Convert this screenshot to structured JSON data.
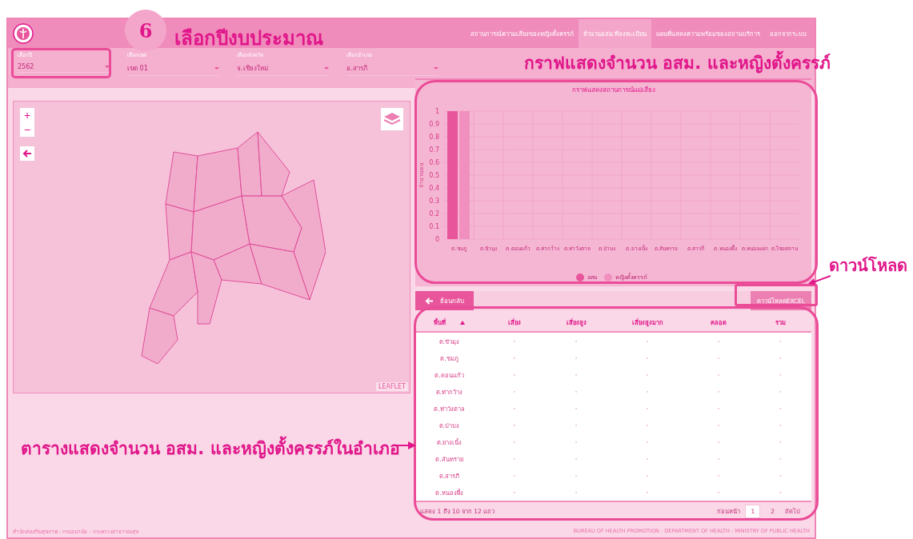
{
  "header": {
    "nav": [
      {
        "label": "สถานการณ์ความเสี่ยงของหญิงตั้งครรภ์",
        "selected": false
      },
      {
        "label": "จำนวนอสม.ที่ลงทะเบียน",
        "selected": true
      },
      {
        "label": "แผนที่แสดงความพร้อมของสถานบริการ",
        "selected": false
      },
      {
        "label": "ออกจากระบบ",
        "selected": false
      }
    ]
  },
  "filters": [
    {
      "label": "เลือกปี",
      "value": "2562"
    },
    {
      "label": "เลือกเขต",
      "value": "เขต 01"
    },
    {
      "label": "เลือกจังหวัด",
      "value": "จ.เชียงใหม่"
    },
    {
      "label": "เลือกอำเภอ",
      "value": "อ.สารภี"
    }
  ],
  "map": {
    "zoom_in": "+",
    "zoom_out": "−",
    "attribution": "LEAFLET"
  },
  "chart": {
    "chart_data": {
      "type": "bar",
      "title": "กราฟแสดงสถานการณ์แม่เสี่ยง",
      "ylabel": "จำนวนคน",
      "categories": [
        "ต.ชมภู",
        "ต.ขัวมุง",
        "ต.ดอนแก้ว",
        "ต.ท่ากว้าง",
        "ต.ท่าวังตาล",
        "ต.ป่าบง",
        "ต.ยางเนิ้ง",
        "ต.สันทราย",
        "ต.สารภี",
        "ต.หนองผึ้ง",
        "ต.หนองแฝก",
        "ต.ไชยสถาน"
      ],
      "series": [
        {
          "name": "อสม",
          "color": "#e8559b",
          "values": [
            1,
            0,
            0,
            0,
            0,
            0,
            0,
            0,
            0,
            0,
            0,
            0
          ]
        },
        {
          "name": "หญิงตั้งครรภ์",
          "color": "#f190bf",
          "values": [
            1,
            0,
            0,
            0,
            0,
            0,
            0,
            0,
            0,
            0,
            0,
            0
          ]
        }
      ],
      "grid": true,
      "ylim": [
        0,
        1
      ],
      "yticks": [
        0,
        0.1,
        0.2,
        0.3,
        0.4,
        0.5,
        0.6,
        0.7,
        0.8,
        0.9,
        1
      ]
    }
  },
  "toolbar": {
    "back": "ย้อนกลับ",
    "download": "ดาวน์โหลดEXCEL"
  },
  "table": {
    "columns": [
      {
        "label": "พื้นที่",
        "sorted": true
      },
      {
        "label": "เสี่ยง",
        "sorted": false
      },
      {
        "label": "เสี่ยงสูง",
        "sorted": false
      },
      {
        "label": "เสี่ยงสูงมาก",
        "sorted": false
      },
      {
        "label": "คลอด",
        "sorted": false
      },
      {
        "label": "รวม",
        "sorted": false
      }
    ],
    "rows": [
      {
        "cells": [
          "ต.ขัวมุง",
          "-",
          "-",
          "-",
          "-",
          "-"
        ]
      },
      {
        "cells": [
          "ต.ชมภู",
          "-",
          "-",
          "-",
          "-",
          "-"
        ]
      },
      {
        "cells": [
          "ต.ดอนแก้ว",
          "-",
          "-",
          "-",
          "-",
          "-"
        ]
      },
      {
        "cells": [
          "ต.ท่ากว้าง",
          "-",
          "-",
          "-",
          "-",
          "-"
        ]
      },
      {
        "cells": [
          "ต.ท่าวังตาล",
          "-",
          "-",
          "-",
          "-",
          "-"
        ]
      },
      {
        "cells": [
          "ต.ป่าบง",
          "-",
          "-",
          "-",
          "-",
          "-"
        ]
      },
      {
        "cells": [
          "ต.ยางเนิ้ง",
          "-",
          "-",
          "-",
          "-",
          "-"
        ]
      },
      {
        "cells": [
          "ต.สันทราย",
          "-",
          "-",
          "-",
          "-",
          "-"
        ]
      },
      {
        "cells": [
          "ต.สารภี",
          "-",
          "-",
          "-",
          "-",
          "-"
        ]
      },
      {
        "cells": [
          "ต.หนองผึ้ง",
          "-",
          "-",
          "-",
          "-",
          "-"
        ]
      }
    ]
  },
  "pagination": {
    "info": "แสดง 1 ถึง 10 จาก 12 แถว",
    "prev": "ก่อนหน้า",
    "pages": [
      {
        "label": "1",
        "selected": true
      },
      {
        "label": "2",
        "selected": false
      }
    ],
    "next": "ถัดไป"
  },
  "footer": {
    "left": "สำนักส่งเสริมสุขภาพ : กรมอนามัย : กระทรวงสาธารณสุข",
    "right": "BUREAU OF HEALTH PROMOTION : DEPARTMENT OF HEALTH : MINISTRY OF PUBLIC HEALTH"
  },
  "annotations": [
    {
      "kind": "step",
      "number": "6",
      "text": "เลือกปีงบประมาณ"
    },
    {
      "kind": "label",
      "text": "กราฟแสดงจำนวน อสม. และหญิงตั้งครรภ์"
    },
    {
      "kind": "label",
      "text": "ดาวน์โหลด"
    },
    {
      "kind": "label",
      "text": "ตารางแสดงจำนวน อสม. และหญิงตั้งครรภ์ในอำเภอ"
    }
  ]
}
